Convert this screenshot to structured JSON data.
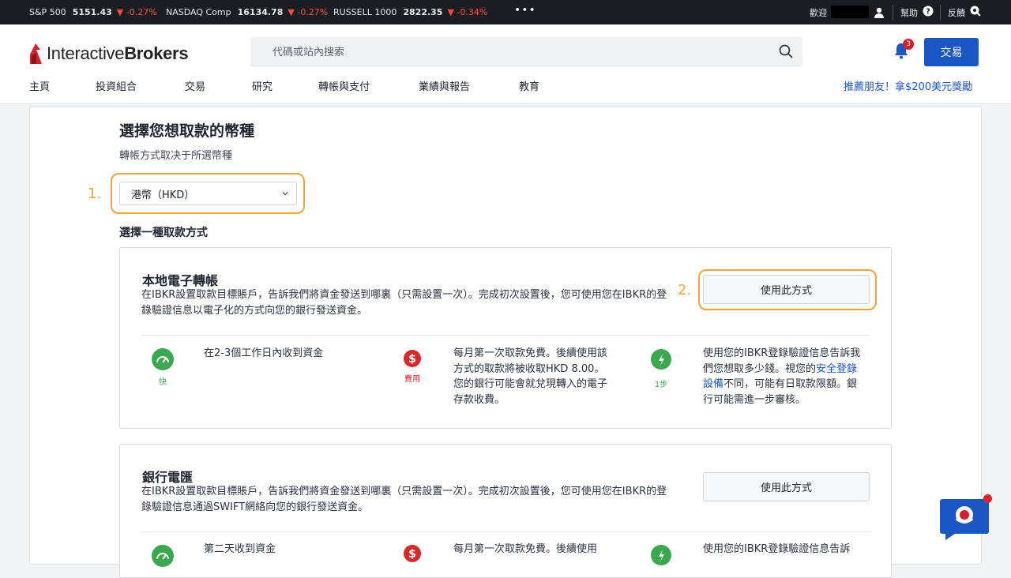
{
  "ticker": [
    {
      "name": "S&P 500",
      "value": "5151.43",
      "change": "-0.27%"
    },
    {
      "name": "NASDAQ Comp",
      "value": "16134.78",
      "change": "-0.27%"
    },
    {
      "name": "RUSSELL 1000",
      "value": "2822.35",
      "change": "-0.34%"
    }
  ],
  "topbar": {
    "more": "•••",
    "welcome": "歡迎",
    "help": "幫助",
    "feedback": "反饋"
  },
  "header": {
    "logo_part1": "Interactive",
    "logo_part2": "Brokers",
    "search_placeholder": "代碼或站內搜索",
    "notification_count": "3",
    "trade_label": "交易"
  },
  "nav": [
    "主頁",
    "投資組合",
    "交易",
    "研究",
    "轉帳與支付",
    "業績與報告",
    "教育"
  ],
  "promo": "推薦朋友！拿$200美元獎勵",
  "main": {
    "title": "選擇您想取款的幣種",
    "subtitle": "轉帳方式取决于所選幣種",
    "step1": "1.",
    "step2": "2.",
    "currency_selected": "港幣（HKD）",
    "method_heading": "選擇一種取款方式",
    "use_method_label": "使用此方式"
  },
  "methods": [
    {
      "title": "本地電子轉帳",
      "desc": "在IBKR設置取款目標賬戶，告訴我們將資金發送到哪裏（只需設置一次）。完成初次設置後，您可使用您在IBKR的登錄驗證信息以電子化的方式向您的銀行發送資金。",
      "speed_cap": "快",
      "speed_text": "在2-3個工作日內收到資金",
      "fee_cap": "費用",
      "fee_text": "每月第一次取款免費。後續使用該方式的取款將被收取HKD 8.00。 您的銀行可能會就兌現轉入的電子存款收費。",
      "steps_cap": "1步",
      "steps_text_a": "使用您的IBKR登錄驗證信息告訴我們您想取多少錢。視您的",
      "steps_link": "安全登錄設備",
      "steps_text_b": "不同，可能有日取款限額。銀行可能需進一步審核。"
    },
    {
      "title": "銀行電匯",
      "desc": "在IBKR設置取款目標賬戶，告訴我們將資金發送到哪裏（只需設置一次）。完成初次設置後，您可使用您在IBKR的登錄驗證信息通過SWIFT網絡向您的銀行發送資金。",
      "speed_text": "第二天收到資金",
      "fee_text": "每月第一次取款免費。後續使用",
      "steps_text": "使用您的IBKR登錄驗證信息告訴"
    }
  ],
  "colors": {
    "accent": "#1a56c4",
    "highlight": "#f0a43a",
    "speed": "#3aa84f",
    "fee": "#d62a2a",
    "ticker_bg": "#1c1d22"
  }
}
